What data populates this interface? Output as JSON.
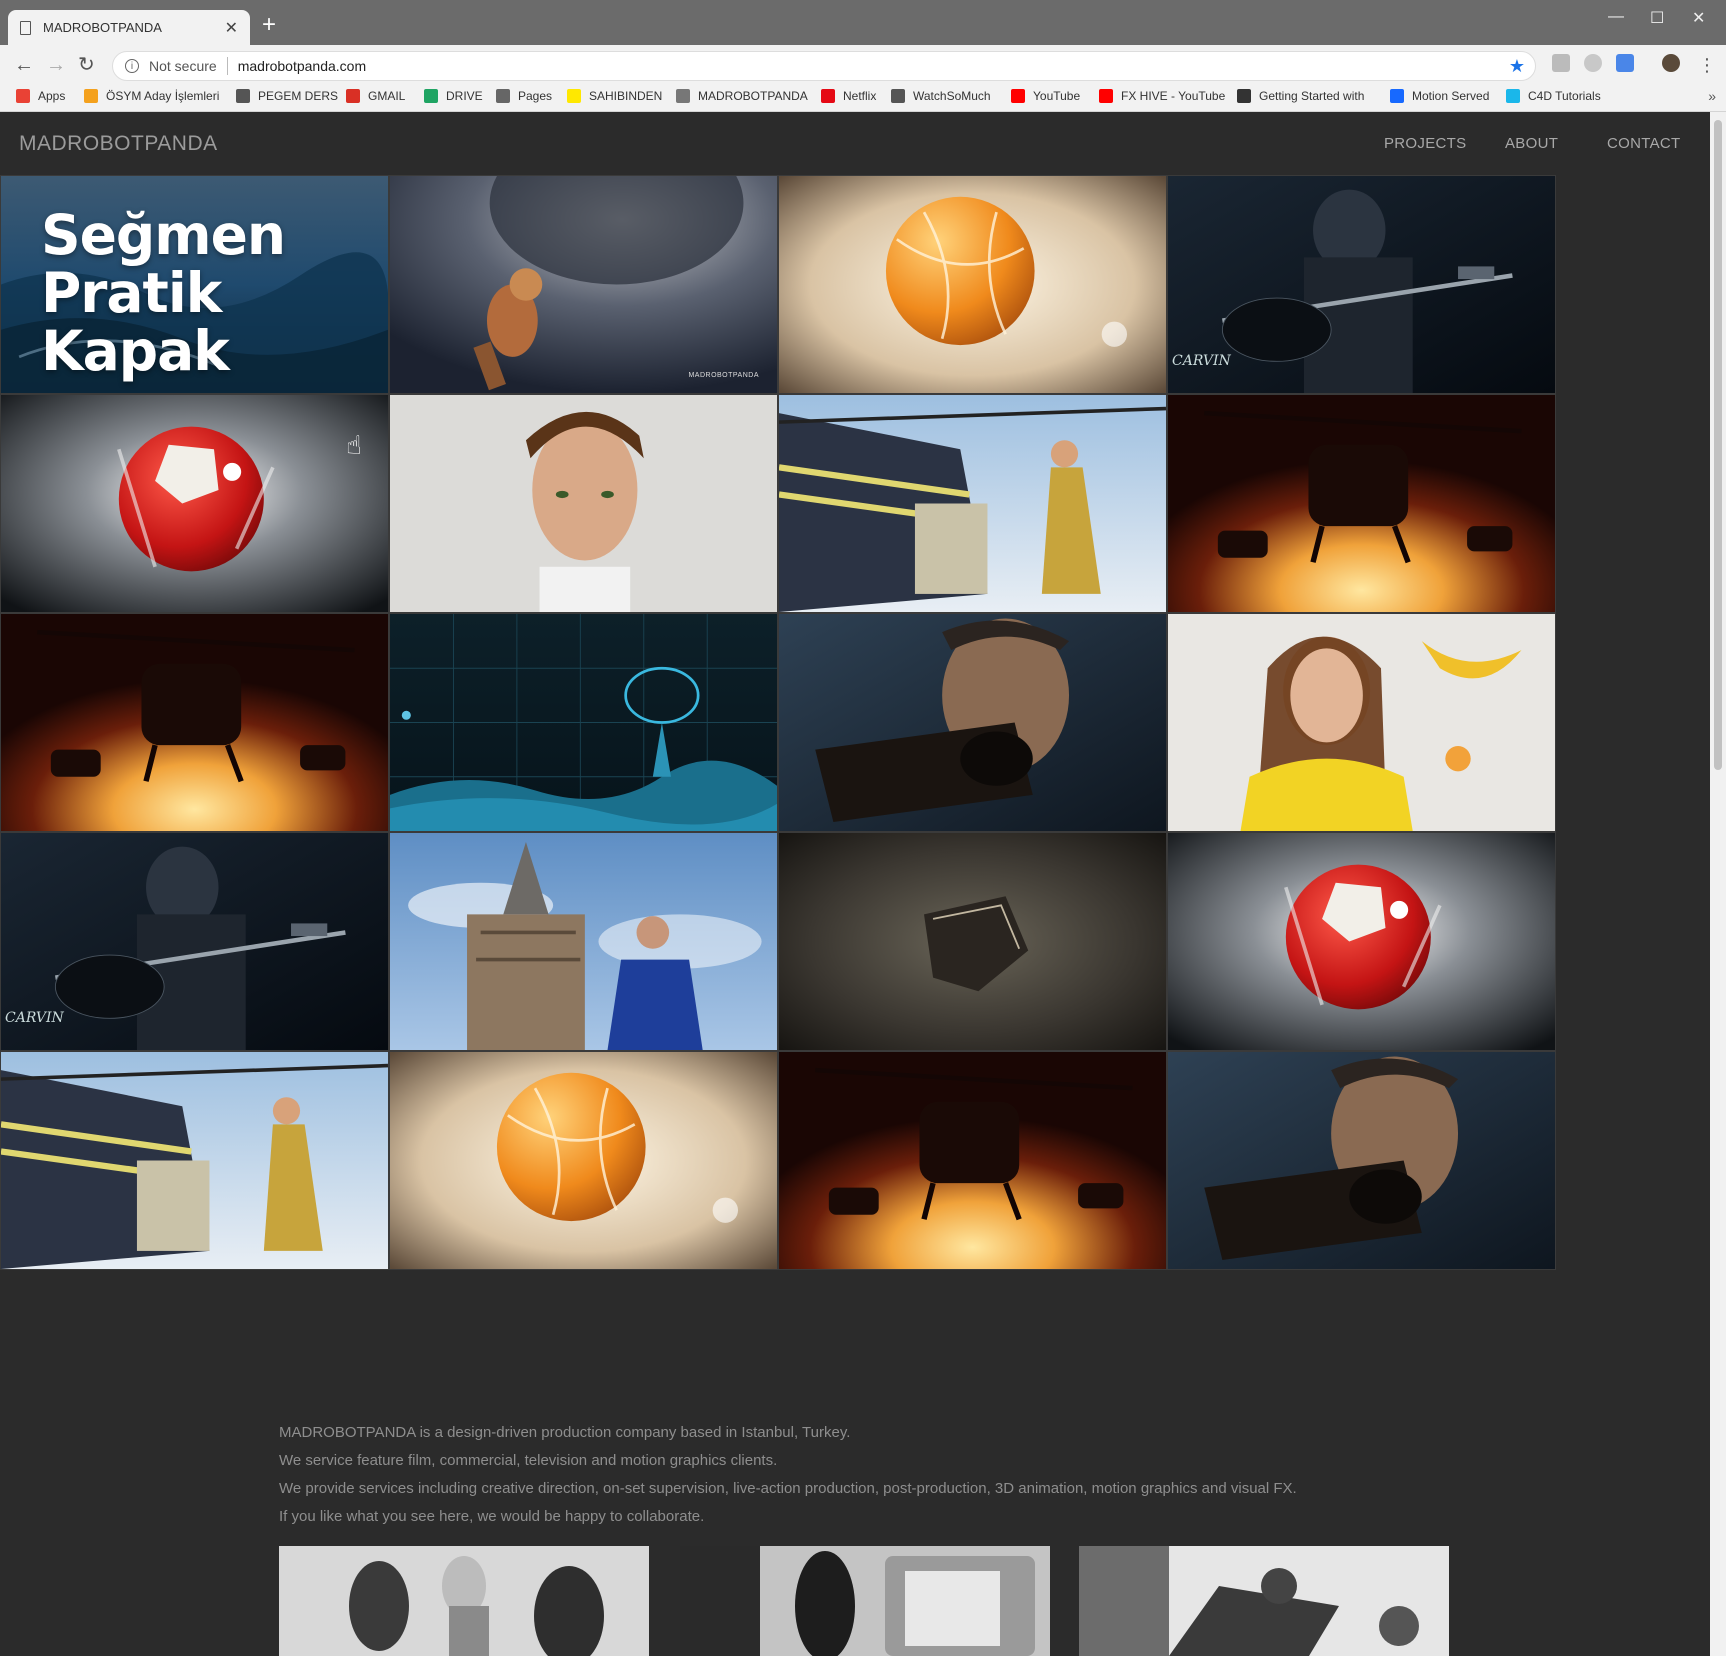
{
  "browser": {
    "tab_title": "MADROBOTPANDA",
    "new_tab": "+",
    "tab_close": "✕",
    "window_controls": [
      "—",
      "☐",
      "✕"
    ],
    "address": {
      "security_label": "Not secure",
      "url": "madrobotpanda.com"
    },
    "bookmarks": [
      {
        "label": "Apps",
        "icon": "apps-grid-icon",
        "color": "#e94235"
      },
      {
        "label": "ÖSYM Aday İşlemleri",
        "icon": "osym-icon",
        "color": "#f4a11d"
      },
      {
        "label": "PEGEM DERS",
        "icon": "pegem-icon",
        "color": "#555555"
      },
      {
        "label": "GMAIL",
        "icon": "gmail-icon",
        "color": "#d93025"
      },
      {
        "label": "DRIVE",
        "icon": "drive-icon",
        "color": "#1fa463"
      },
      {
        "label": "Pages",
        "icon": "apple-icon",
        "color": "#666666"
      },
      {
        "label": "SAHIBINDEN",
        "icon": "sahibinden-icon",
        "color": "#ffe800"
      },
      {
        "label": "MADROBOTPANDA",
        "icon": "page-icon",
        "color": "#777777"
      },
      {
        "label": "Netflix",
        "icon": "netflix-icon",
        "color": "#e50914"
      },
      {
        "label": "WatchSoMuch",
        "icon": "watchsomuch-icon",
        "color": "#555555"
      },
      {
        "label": "YouTube",
        "icon": "youtube-icon",
        "color": "#ff0000"
      },
      {
        "label": "FX HIVE - YouTube",
        "icon": "youtube-icon",
        "color": "#ff0000"
      },
      {
        "label": "Getting Started with",
        "icon": "c-icon",
        "color": "#333333"
      },
      {
        "label": "Motion Served",
        "icon": "behance-icon",
        "color": "#1769ff"
      },
      {
        "label": "C4D Tutorials",
        "icon": "vimeo-icon",
        "color": "#1ab7ea"
      }
    ],
    "bookmarks_more": "»"
  },
  "site": {
    "logo": "MADROBOTPANDA",
    "nav": [
      {
        "label": "PROJECTS",
        "active": true
      },
      {
        "label": "ABOUT",
        "active": false
      },
      {
        "label": "CONTACT",
        "active": false
      }
    ]
  },
  "tiles": [
    {
      "scene": "sea-title",
      "caption": [
        "Seğmen",
        "Pratik",
        "Kapak"
      ]
    },
    {
      "scene": "astronaut",
      "watermark": "MADROBOTPANDA"
    },
    {
      "scene": "orange-ball"
    },
    {
      "scene": "guitarist",
      "brand": "CARVIN"
    },
    {
      "scene": "red-ball"
    },
    {
      "scene": "portrait-man"
    },
    {
      "scene": "helicopter-woman"
    },
    {
      "scene": "helicopter-sunset"
    },
    {
      "scene": "helicopter-sunset"
    },
    {
      "scene": "satellite-dish"
    },
    {
      "scene": "man-binoculars"
    },
    {
      "scene": "girl-portrait"
    },
    {
      "scene": "guitarist",
      "brand": "CARVIN"
    },
    {
      "scene": "galata-tower"
    },
    {
      "scene": "spaceship"
    },
    {
      "scene": "red-ball"
    },
    {
      "scene": "helicopter-woman"
    },
    {
      "scene": "orange-ball"
    },
    {
      "scene": "helicopter-sunset"
    },
    {
      "scene": "man-binoculars"
    }
  ],
  "about": [
    "MADROBOTPANDA is a design-driven production company based in Istanbul, Turkey.",
    "We service feature film, commercial, television and motion graphics clients.",
    "We provide services including creative direction, on-set supervision, live-action production, post-production, 3D animation, motion graphics and visual FX.",
    "If you like what you see here, we would be happy to collaborate."
  ],
  "colors": {
    "accent": "#2aa59a",
    "background": "#2b2b2b",
    "text_muted": "#8e8e8e"
  }
}
